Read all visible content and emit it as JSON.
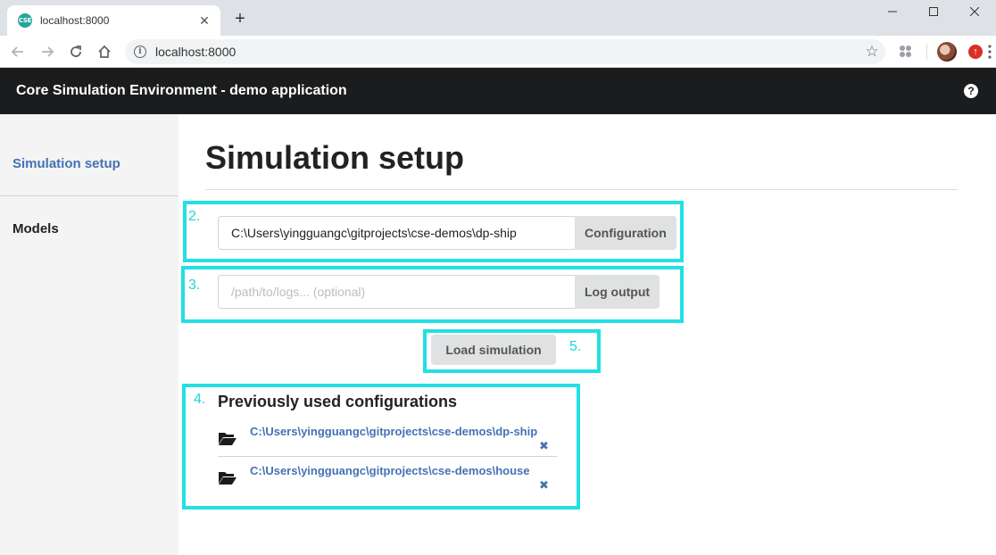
{
  "browser": {
    "tab_title": "localhost:8000",
    "favicon_text": "CSE",
    "url": "localhost:8000",
    "new_tab": "+",
    "icons": [
      "back-icon",
      "forward-icon",
      "reload-icon",
      "home-icon",
      "info-icon",
      "star-icon",
      "extension-icon",
      "profile-avatar",
      "update-icon",
      "menu-icon"
    ]
  },
  "app": {
    "title": "Core Simulation Environment - demo application",
    "help": "?"
  },
  "sidebar": {
    "items": [
      {
        "label": "Simulation setup",
        "active": true
      },
      {
        "label": "Models",
        "active": false
      }
    ]
  },
  "main": {
    "page_title": "Simulation setup",
    "config": {
      "value": "C:\\Users\\yingguangc\\gitprojects\\cse-demos\\dp-ship",
      "button": "Configuration"
    },
    "log": {
      "placeholder": "/path/to/logs... (optional)",
      "button": "Log output"
    },
    "load_button": "Load simulation",
    "previous": {
      "heading": "Previously used configurations",
      "items": [
        "C:\\Users\\yingguangc\\gitprojects\\cse-demos\\dp-ship",
        "C:\\Users\\yingguangc\\gitprojects\\cse-demos\\house"
      ]
    }
  },
  "annotations": {
    "labels": [
      "2.",
      "3.",
      "4.",
      "5."
    ],
    "color": "#22e0e4"
  },
  "colors": {
    "header_bg": "#1b1c1d",
    "link": "#4472b4",
    "sidebar_bg": "#f4f4f4",
    "button_bg": "#e0e1e2"
  }
}
